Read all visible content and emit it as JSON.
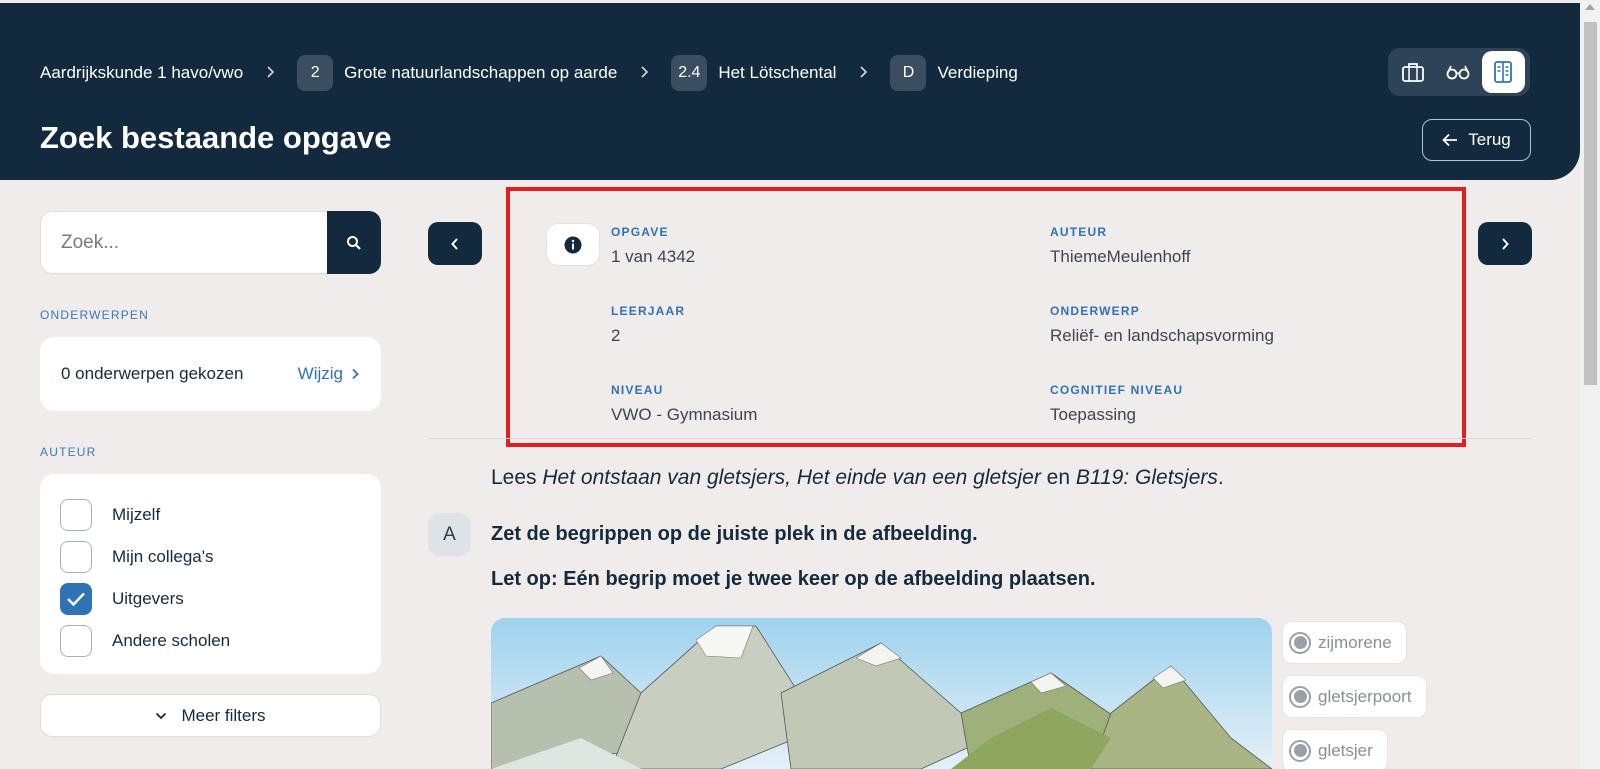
{
  "breadcrumb": [
    {
      "badge": "",
      "label": "Aardrijkskunde 1 havo/vwo"
    },
    {
      "badge": "2",
      "label": "Grote natuurlandschappen op aarde"
    },
    {
      "badge": "2.4",
      "label": "Het Lötschental"
    },
    {
      "badge": "D",
      "label": "Verdieping"
    }
  ],
  "header": {
    "title": "Zoek bestaande opgave",
    "back_label": "Terug",
    "view_toggle": [
      "briefcase-icon",
      "glasses-icon",
      "book-open-icon"
    ]
  },
  "sidebar": {
    "search": {
      "placeholder": "Zoek...",
      "value": ""
    },
    "topics_label": "ONDERWERPEN",
    "topics_chosen": "0 onderwerpen gekozen",
    "topics_edit": "Wijzig",
    "author_label": "AUTEUR",
    "authors": [
      {
        "label": "Mijzelf",
        "checked": false
      },
      {
        "label": "Mijn collega's",
        "checked": false
      },
      {
        "label": "Uitgevers",
        "checked": true
      },
      {
        "label": "Andere scholen",
        "checked": false
      }
    ],
    "more_filters": "Meer filters"
  },
  "meta": {
    "opgave_label": "OPGAVE",
    "opgave_value": "1 van 4342",
    "auteur_label": "AUTEUR",
    "auteur_value": "ThiemeMeulenhoff",
    "leerjaar_label": "LEERJAAR",
    "leerjaar_value": "2",
    "onderwerp_label": "ONDERWERP",
    "onderwerp_value": "Reliëf- en landschapsvorming",
    "niveau_label": "NIVEAU",
    "niveau_value": "VWO - Gymnasium",
    "cognitief_label": "COGNITIEF NIVEAU",
    "cognitief_value": "Toepassing"
  },
  "question": {
    "lees_prefix": "Lees ",
    "lees_source1": "Het ontstaan van gletsjers, Het einde van een gletsjer",
    "lees_mid": " en ",
    "lees_source2": "B119: Gletsjers",
    "lees_suffix": ".",
    "letter": "A",
    "instruction": "Zet de begrippen op de juiste plek in de afbeelding.",
    "note": "Let op: Eén begrip moet je twee keer op de afbeelding plaatsen.",
    "terms": [
      "zijmorene",
      "gletsjerpoort",
      "gletsjer"
    ]
  },
  "colors": {
    "header_bg": "#13293d",
    "accent_blue": "#2f73b5",
    "highlight_red": "#e41e1e",
    "page_bg": "#efeceb"
  }
}
